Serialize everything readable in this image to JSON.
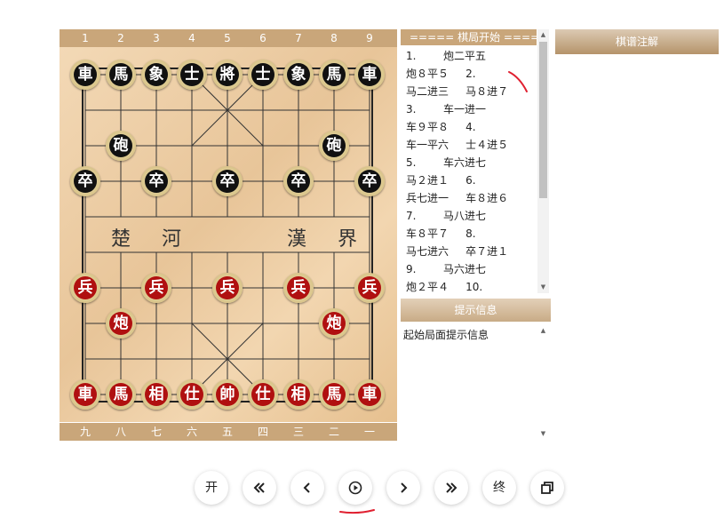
{
  "top_files": [
    "1",
    "2",
    "3",
    "4",
    "5",
    "6",
    "7",
    "8",
    "9"
  ],
  "bottom_files": [
    "九",
    "八",
    "七",
    "六",
    "五",
    "四",
    "三",
    "二",
    "一"
  ],
  "river": {
    "left": "楚 河",
    "right": "漢 界"
  },
  "pieces": {
    "black_back": [
      "車",
      "馬",
      "象",
      "士",
      "將",
      "士",
      "象",
      "馬",
      "車"
    ],
    "black_cannon": "砲",
    "black_pawn": "卒",
    "red_back": [
      "車",
      "馬",
      "相",
      "仕",
      "帥",
      "仕",
      "相",
      "馬",
      "車"
    ],
    "red_cannon": "炮",
    "red_pawn": "兵"
  },
  "moves": {
    "header": "===== 棋局开始 =====",
    "lines": [
      "1.        炮二平五",
      "炮８平５     2.",
      "马二进三     马８进７",
      "3.        车一进一",
      "车９平８     4.",
      "车一平六     士４进５",
      "5.        车六进七",
      "马２进１     6.",
      "兵七进一     车８进６",
      "7.        马八进七",
      "车８平７     8.",
      "马七进六     卒７进１",
      "9.        马六进七",
      "炮２平４     10."
    ]
  },
  "hint": {
    "title": "提示信息",
    "text": "起始局面提示信息"
  },
  "annotation": {
    "title": "棋谱注解"
  },
  "controls": {
    "start": "开",
    "end": "终"
  },
  "colors": {
    "black_piece": "#111111",
    "red_piece": "#b01010",
    "strip": "#c9a67a",
    "annotation_mark": "#e02030"
  }
}
